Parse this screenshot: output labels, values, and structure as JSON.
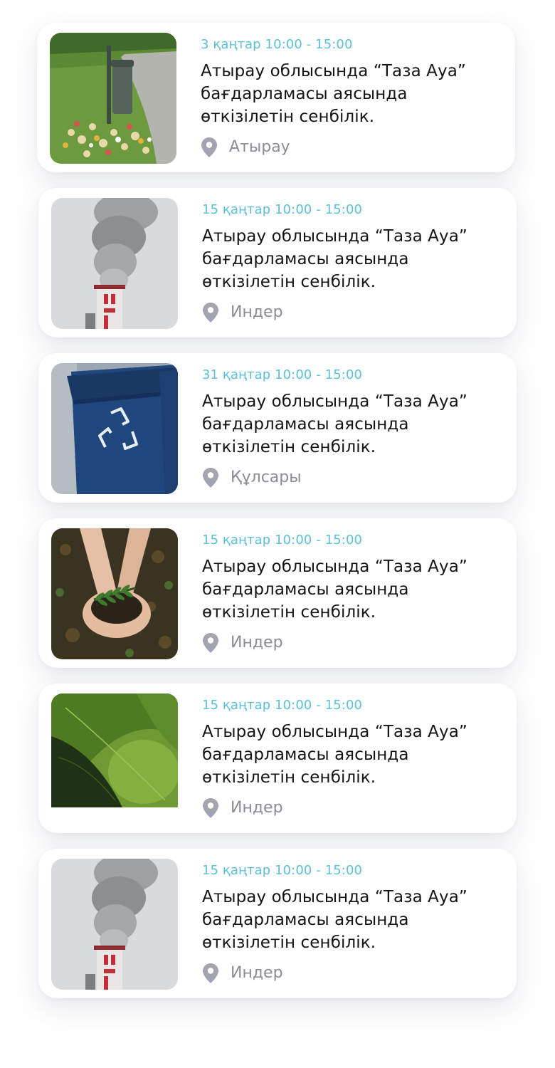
{
  "events": [
    {
      "date": "3 қаңтар 10:00 - 15:00",
      "title": "Атырау облысында “Таза Ауа” бағдарламасы аясында өткізілетін сенбілік.",
      "location": "Атырау",
      "image": "park-trash-photo"
    },
    {
      "date": "15 қаңтар 10:00 - 15:00",
      "title": "Атырау облысында “Таза Ауа” бағдарламасы аясында өткізілетін сенбілік.",
      "location": "Индер",
      "image": "chimney-smoke-photo"
    },
    {
      "date": "31 қаңтар 10:00 - 15:00",
      "title": "Атырау облысында “Таза Ауа” бағдарламасы аясында өткізілетін сенбілік.",
      "location": "Құлсары",
      "image": "recycling-bin-photo"
    },
    {
      "date": "15 қаңтар 10:00 - 15:00",
      "title": "Атырау облысында “Таза Ауа” бағдарламасы аясында өткізілетін сенбілік.",
      "location": "Индер",
      "image": "hands-soil-plant-photo"
    },
    {
      "date": "15 қаңтар 10:00 - 15:00",
      "title": "Атырау облысында “Таза Ауа” бағдарламасы аясында өткізілетін сенбілік.",
      "location": "Индер",
      "image": "green-leaf-photo"
    },
    {
      "date": "15 қаңтар 10:00 - 15:00",
      "title": "Атырау облысында “Таза Ауа” бағдарламасы аясында өткізілетін сенбілік.",
      "location": "Индер",
      "image": "chimney-smoke-photo"
    }
  ],
  "colors": {
    "date": "#5cc0d6",
    "title": "#141414",
    "location": "#8c8c98",
    "pin": "#a3a3b2",
    "card": "#ffffff"
  },
  "icons": {
    "location": "map-pin-icon"
  }
}
